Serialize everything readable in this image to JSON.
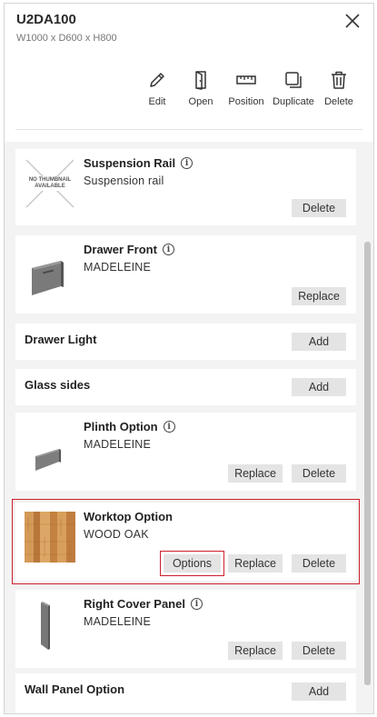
{
  "header": {
    "title": "U2DA100",
    "subtitle": "W1000 x D600 x H800"
  },
  "toolbar": {
    "edit": "Edit",
    "open": "Open",
    "position": "Position",
    "duplicate": "Duplicate",
    "delete": "Delete"
  },
  "items": [
    {
      "name": "Suspension Rail",
      "description": "Suspension rail",
      "thumbnail": "NO THUMBNAIL AVAILABLE",
      "buttons": [
        "Delete"
      ]
    },
    {
      "name": "Drawer Front",
      "description": "MADELEINE",
      "buttons": [
        "Replace"
      ]
    },
    {
      "name": "Drawer Light",
      "buttons": [
        "Add"
      ]
    },
    {
      "name": "Glass sides",
      "buttons": [
        "Add"
      ]
    },
    {
      "name": "Plinth Option",
      "description": "MADELEINE",
      "buttons": [
        "Replace",
        "Delete"
      ]
    },
    {
      "name": "Worktop Option",
      "description": "WOOD OAK",
      "buttons": [
        "Options",
        "Replace",
        "Delete"
      ],
      "selected": true
    },
    {
      "name": "Right Cover Panel",
      "description": "MADELEINE",
      "buttons": [
        "Replace",
        "Delete"
      ]
    },
    {
      "name": "Wall Panel Option",
      "buttons": [
        "Add"
      ]
    }
  ],
  "colors": {
    "accent": "#cc1f2b",
    "button_bg": "#e4e4e4",
    "list_bg": "#f3f3f3"
  }
}
